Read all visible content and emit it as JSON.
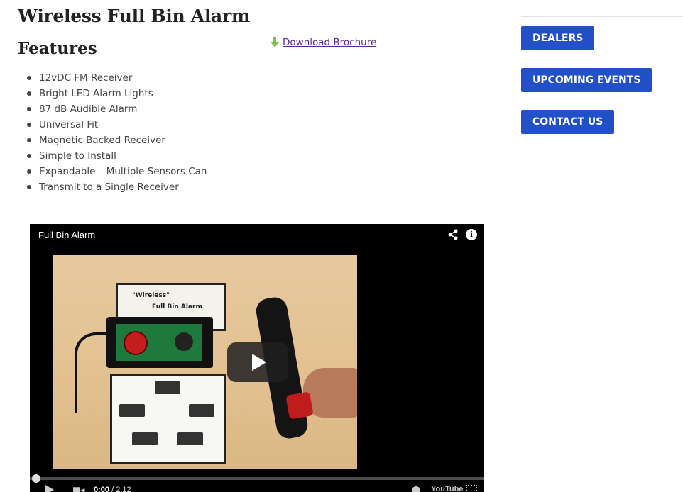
{
  "product": {
    "title": "Wireless Full Bin Alarm",
    "features_heading": "Features",
    "brochure_link": "Download Brochure",
    "features": [
      "12vDC FM Receiver",
      "Bright LED Alarm Lights",
      "87 dB Audible Alarm",
      "Universal Fit",
      "Magnetic Backed Receiver",
      "Simple to Install",
      "Expandable – Multiple Sensors Can",
      "Transmit to a Single Receiver"
    ]
  },
  "video": {
    "title": "Full Bin Alarm",
    "frame_card_line1": "\"Wireless\"",
    "frame_card_line2": "Full Bin Alarm",
    "current_time": "0:00",
    "duration": "2:12",
    "progress": 0,
    "youtube_label": "YouTube",
    "share_icon": "share-icon",
    "info_icon": "info-icon",
    "play_icon": "play-icon",
    "volume_icon": "volume-icon",
    "fullscreen_icon": "fullscreen-icon"
  },
  "sidebar": {
    "buttons": [
      {
        "label": "DEALERS"
      },
      {
        "label": "UPCOMING EVENTS"
      },
      {
        "label": "CONTACT US"
      }
    ]
  },
  "colors": {
    "button_bg": "#2250c8",
    "link": "#5a2a8a",
    "arrow_green": "#7cc242"
  }
}
